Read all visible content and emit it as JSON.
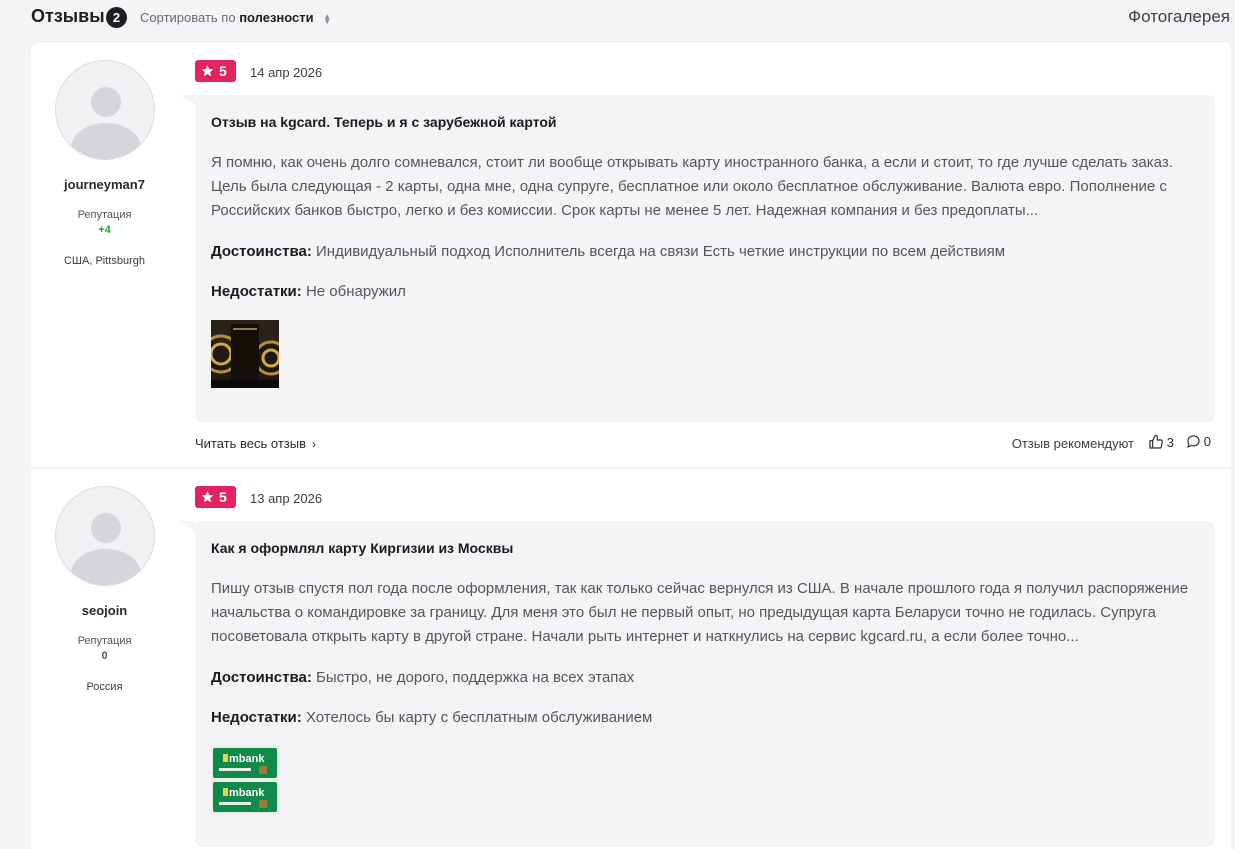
{
  "header": {
    "title": "Отзывы",
    "count": "2",
    "sort_prefix": "Сортировать по",
    "sort_value": "полезности",
    "gallery": "Фотогалерея"
  },
  "reviews": [
    {
      "username": "journeyman7",
      "rep_label": "Репутация",
      "rep_value": "+4",
      "location": "США, Pittsburgh",
      "rating": "5",
      "date": "14 апр 2026",
      "title": "Отзыв на kgcard. Теперь и я с зарубежной картой",
      "text": "Я помню, как очень долго сомневался, стоит ли вообще открывать карту иностранного банка, а если и стоит, то где лучше сделать заказ. Цель была следующая - 2 карты, одна мне, одна супруге, бесплатное или около бесплатное обслуживание. Валюта евро. Пополнение с Российских банков быстро, легко и без комиссии. Срок карты не менее 5 лет. Надежная компания и без предоплаты...",
      "pros_label": "Достоинства:",
      "pros": "Индивидуальный подход Исполнитель всегда на связи Есть четкие инструкции по всем действиям",
      "cons_label": "Недостатки:",
      "cons": "Не обнаружил",
      "read_more": "Читать весь отзыв",
      "recommend": "Отзыв рекомендуют",
      "likes": "3",
      "comments": "0"
    },
    {
      "username": "seojoin",
      "rep_label": "Репутация",
      "rep_value": "0",
      "location": "Россия",
      "rating": "5",
      "date": "13 апр 2026",
      "title": "Как я оформлял карту Киргизии из Москвы",
      "text": "Пишу отзыв спустя пол года после оформления, так как только сейчас вернулся из США. В начале прошлого года я получил распоряжение начальства о командировке за границу. Для меня это был не первый опыт, но предыдущая карта Беларуси точно не годилась. Супруга посоветовала открыть карту в другой стране. Начали рыть интернет и наткнулись на сервис kgcard.ru, а если более точно...",
      "pros_label": "Достоинства:",
      "pros": "Быстро, не дорого, поддержка на всех этапах",
      "cons_label": "Недостатки:",
      "cons": "Хотелось бы карту с бесплатным обслуживанием",
      "card_brand": "mbank"
    }
  ],
  "colors": {
    "rating_badge": "#e2235f",
    "reputation_positive": "#1f9d2f",
    "card_green": "#0f8a4a"
  },
  "icons": [
    "star-icon",
    "sort-icon",
    "chevron-right-icon",
    "thumbs-up-icon",
    "comment-icon",
    "avatar-placeholder-icon"
  ]
}
